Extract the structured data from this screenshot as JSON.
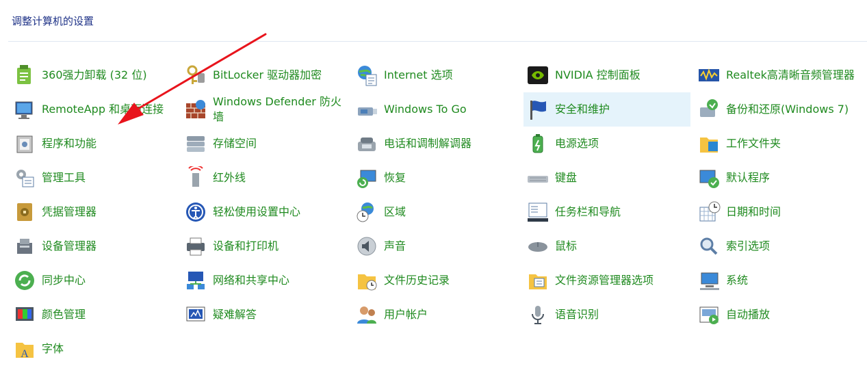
{
  "header": {
    "title": "调整计算机的设置"
  },
  "items": [
    {
      "label": "360强力卸载 (32 位)",
      "icon": "uninstall-icon"
    },
    {
      "label": "BitLocker 驱动器加密",
      "icon": "bitlocker-key-icon"
    },
    {
      "label": "Internet 选项",
      "icon": "internet-options-icon"
    },
    {
      "label": "NVIDIA 控制面板",
      "icon": "nvidia-icon"
    },
    {
      "label": "Realtek高清晰音频管理器",
      "icon": "realtek-audio-icon"
    },
    {
      "label": "RemoteApp 和桌面连接",
      "icon": "remoteapp-icon"
    },
    {
      "label": "Windows Defender 防火墙",
      "icon": "firewall-icon"
    },
    {
      "label": "Windows To Go",
      "icon": "usb-drive-icon"
    },
    {
      "label": "安全和维护",
      "icon": "security-flag-icon"
    },
    {
      "label": "备份和还原(Windows 7)",
      "icon": "backup-icon"
    },
    {
      "label": "程序和功能",
      "icon": "programs-icon"
    },
    {
      "label": "存储空间",
      "icon": "storage-spaces-icon"
    },
    {
      "label": "电话和调制解调器",
      "icon": "phone-modem-icon"
    },
    {
      "label": "电源选项",
      "icon": "power-options-icon"
    },
    {
      "label": "工作文件夹",
      "icon": "work-folders-icon"
    },
    {
      "label": "管理工具",
      "icon": "admin-tools-icon"
    },
    {
      "label": "红外线",
      "icon": "infrared-icon"
    },
    {
      "label": "恢复",
      "icon": "recovery-icon"
    },
    {
      "label": "键盘",
      "icon": "keyboard-icon"
    },
    {
      "label": "默认程序",
      "icon": "default-programs-icon"
    },
    {
      "label": "凭据管理器",
      "icon": "credential-manager-icon"
    },
    {
      "label": "轻松使用设置中心",
      "icon": "ease-of-access-icon"
    },
    {
      "label": "区域",
      "icon": "region-icon"
    },
    {
      "label": "任务栏和导航",
      "icon": "taskbar-icon"
    },
    {
      "label": "日期和时间",
      "icon": "date-time-icon"
    },
    {
      "label": "设备管理器",
      "icon": "device-manager-icon"
    },
    {
      "label": "设备和打印机",
      "icon": "printer-icon"
    },
    {
      "label": "声音",
      "icon": "sound-icon"
    },
    {
      "label": "鼠标",
      "icon": "mouse-icon"
    },
    {
      "label": "索引选项",
      "icon": "indexing-icon"
    },
    {
      "label": "同步中心",
      "icon": "sync-center-icon"
    },
    {
      "label": "网络和共享中心",
      "icon": "network-icon"
    },
    {
      "label": "文件历史记录",
      "icon": "file-history-icon"
    },
    {
      "label": "文件资源管理器选项",
      "icon": "explorer-options-icon"
    },
    {
      "label": "系统",
      "icon": "system-icon"
    },
    {
      "label": "颜色管理",
      "icon": "color-management-icon"
    },
    {
      "label": "疑难解答",
      "icon": "troubleshooting-icon"
    },
    {
      "label": "用户帐户",
      "icon": "user-accounts-icon"
    },
    {
      "label": "语音识别",
      "icon": "speech-icon"
    },
    {
      "label": "自动播放",
      "icon": "autoplay-icon"
    },
    {
      "label": "字体",
      "icon": "fonts-icon"
    }
  ],
  "highlighted_item": "安全和维护",
  "annotation": {
    "arrow_color": "#e8141c"
  },
  "colors": {
    "link": "#1f8a1f",
    "header": "#1e3287",
    "highlight": "#e5f3fb"
  }
}
